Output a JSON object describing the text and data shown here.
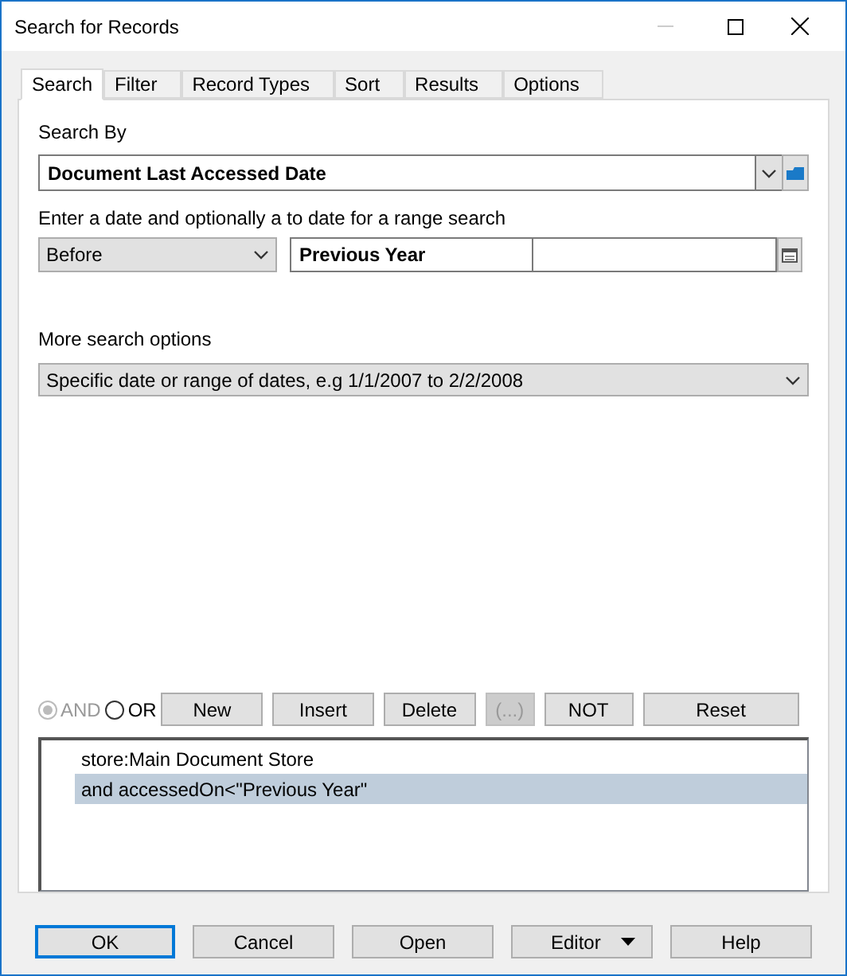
{
  "window": {
    "title": "Search for Records"
  },
  "tabs": [
    {
      "label": "Search",
      "selected": true
    },
    {
      "label": "Filter",
      "selected": false
    },
    {
      "label": "Record Types",
      "selected": false
    },
    {
      "label": "Sort",
      "selected": false
    },
    {
      "label": "Results",
      "selected": false
    },
    {
      "label": "Options",
      "selected": false
    }
  ],
  "search_by": {
    "label": "Search By",
    "value": "Document Last Accessed Date"
  },
  "date_range": {
    "label": "Enter a date and optionally a to date for a range search",
    "operator": "Before",
    "from": "Previous Year"
  },
  "more_options": {
    "label": "More search options",
    "value": "Specific date or range of dates, e.g 1/1/2007 to 2/2/2008"
  },
  "logic": [
    {
      "label": "AND",
      "selected": true,
      "disabled": true
    },
    {
      "label": "OR",
      "selected": false,
      "disabled": false
    }
  ],
  "actions": [
    {
      "label": "New",
      "disabled": false
    },
    {
      "label": "Insert",
      "disabled": false
    },
    {
      "label": "Delete",
      "disabled": false
    },
    {
      "label": "(...)",
      "disabled": true
    },
    {
      "label": "NOT",
      "disabled": false
    },
    {
      "label": "Reset",
      "disabled": false
    }
  ],
  "query_lines": [
    {
      "text": "store:Main Document Store",
      "selected": false
    },
    {
      "text": "and accessedOn<\"Previous Year\"",
      "selected": true
    }
  ],
  "buttons": [
    {
      "label": "OK",
      "kind": "default"
    },
    {
      "label": "Cancel",
      "kind": "plain"
    },
    {
      "label": "Open",
      "kind": "plain"
    },
    {
      "label": "Editor",
      "kind": "menu"
    },
    {
      "label": "Help",
      "kind": "plain"
    }
  ]
}
